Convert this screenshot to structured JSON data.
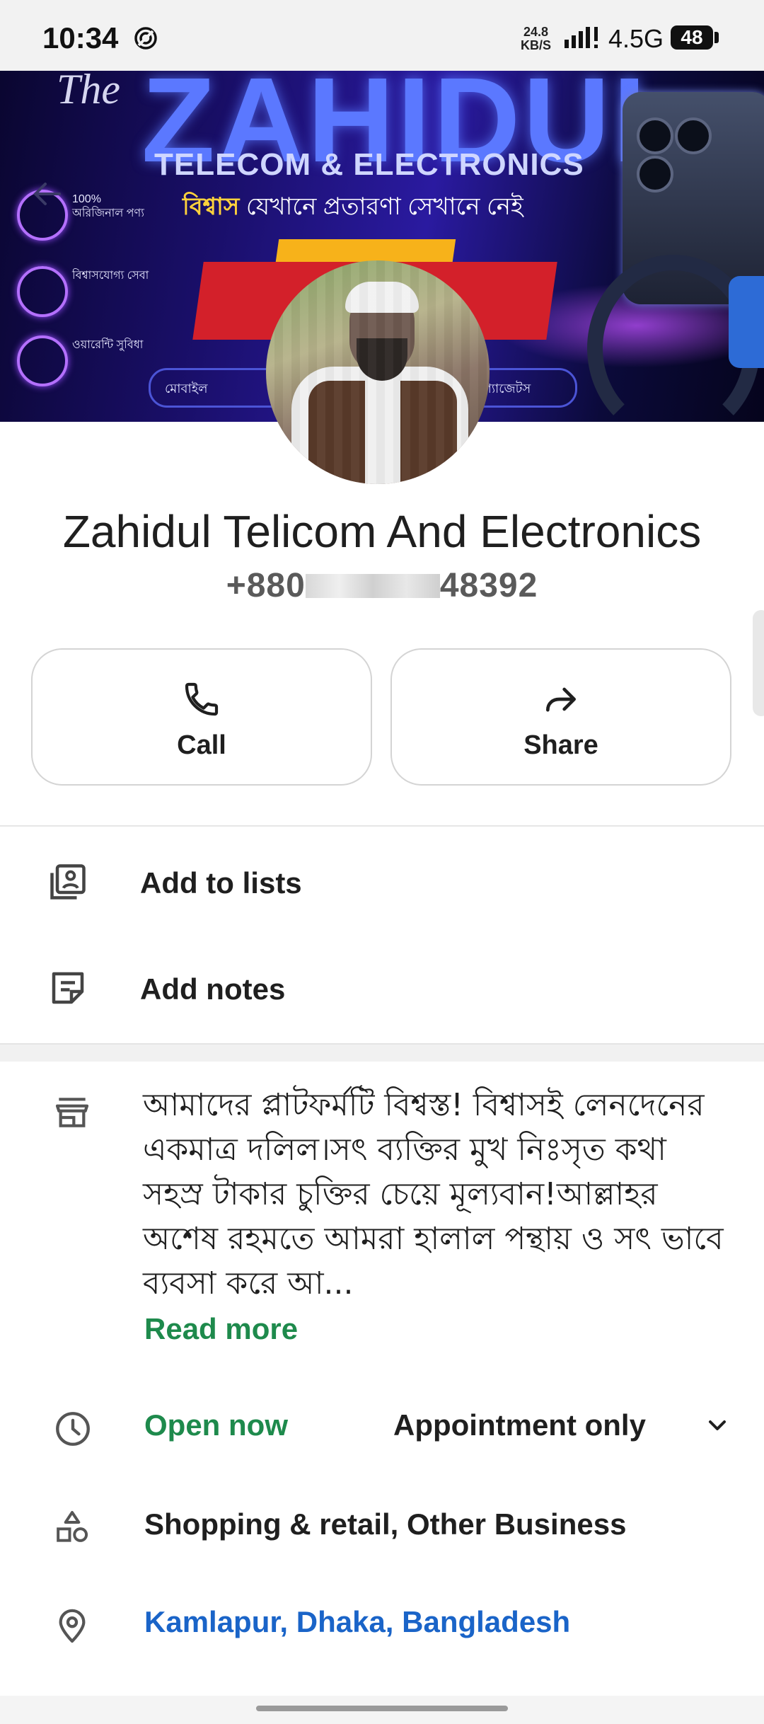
{
  "status_bar": {
    "time": "10:34",
    "speed_value": "24.8",
    "speed_unit": "KB/S",
    "network": "4.5G",
    "battery": "48"
  },
  "banner": {
    "the": "The",
    "brand": "ZAHIDUL",
    "subtitle": "TELECOM & ELECTRONICS",
    "tagline_highlight": "বিশ্বাস",
    "tagline_rest": " যেখানে প্রতারণা সেখানে নেই",
    "features": [
      {
        "text": "100% অরিজিনাল পণ্য"
      },
      {
        "text": "বিশ্বাসযোগ্য সেবা"
      },
      {
        "text": "ওয়ারেন্টি সুবিধা"
      }
    ],
    "chip_left": "মোবাইল",
    "chip_right": "মার্ট গ্যাজেটস"
  },
  "profile": {
    "name": "Zahidul Telicom And Electronics",
    "phone_prefix": "+880",
    "phone_suffix": "48392"
  },
  "actions": {
    "call_label": "Call",
    "share_label": "Share"
  },
  "menu": {
    "add_to_lists": "Add to lists",
    "add_notes": "Add notes"
  },
  "about": {
    "text": "আমাদের প্লাটফর্মটি বিশ্বস্ত! বিশ্বাসই লেনদেনের একমাত্র দলিল।সৎ ব্যক্তির মুখ নিঃসৃত কথা সহস্র টাকার চুক্তির চেয়ে মূল্যবান!আল্লাহর অশেষ রহমতে আমরা হালাল পন্থায় ও সৎ ভাবে ব্যবসা করে আ...",
    "read_more": "Read more"
  },
  "hours": {
    "status": "Open now",
    "detail": "Appointment only"
  },
  "category": "Shopping & retail, Other Business",
  "location": "Kamlapur, Dhaka, Bangladesh",
  "colors": {
    "green": "#1e8a4c",
    "link_blue": "#1a64c8"
  }
}
